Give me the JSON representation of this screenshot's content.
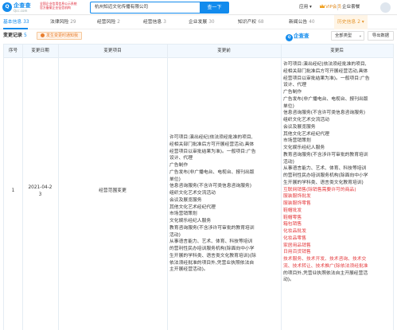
{
  "header": {
    "logo_name": "企查查",
    "logo_domain": "Qcc.com",
    "slogan_lines": [
      "全国企业信用信息公示系统",
      "官方备案企业征信机构"
    ],
    "search_value": "杭州知迈文化传播有限公司",
    "search_button": "查一下",
    "nav_app": "应用",
    "nav_vip": "VIP会员",
    "nav_login": "企业套餐"
  },
  "tabs": [
    {
      "label": "基本信息",
      "count": "33"
    },
    {
      "label": "法律风险",
      "count": "29"
    },
    {
      "label": "经营风险",
      "count": "2"
    },
    {
      "label": "经营信息",
      "count": "3"
    },
    {
      "label": "企业发展",
      "count": "30"
    },
    {
      "label": "知识产权",
      "count": "68"
    },
    {
      "label": "新闻公告",
      "count": "40"
    },
    {
      "label": "历史信息",
      "count": "2"
    }
  ],
  "section": {
    "title": "变更记录",
    "count": "5",
    "warning": "发生变更时通知我",
    "watermark": "企查查",
    "filter_type": "全部类型",
    "export": "导出数据"
  },
  "table": {
    "headers": [
      "序号",
      "变更日期",
      "变更项目",
      "变更前",
      "变更后"
    ],
    "rows": [
      {
        "index": "1",
        "date_lines": [
          "2021-04-2",
          "3"
        ],
        "item": "经营范围变更",
        "before_lines": [
          "许可项目:演出经纪(依法须经批准的项目,",
          "经相关部门批准后方可开展经营活动,具体",
          "经营项目以审批结果为准)。一般项目:广告",
          "设计、代理",
          "广告制作",
          "广告发布(非广播电台、电视台、报刊出版",
          "单位)",
          "信息咨询服务(不含许可类信息咨询服务)",
          "组织文化艺术交流活动",
          "会议及展览服务",
          "其他文化艺术经纪代理",
          "市场营销策划",
          "文化娱乐经纪人服务",
          "教育咨询服务(不含涉许可审批的教育培训",
          "活动)",
          "从事语言能力、艺术、体育、科技等培训",
          "的营利性民办培训服务机构(除面向中小学",
          "生开展的学科类、语言类文化教育培训)(除",
          "依法须经批准的项目外,凭营业执照依法自",
          "主开展经营活动)。"
        ],
        "after_lines": [
          {
            "text": "许可项目:演出经纪(依法须经批准的项目,",
            "hl": false
          },
          {
            "text": "经相关部门批准后方可开展经营活动,具体",
            "hl": false
          },
          {
            "text": "经营项目以审批结果为准)。一般项目:广告",
            "hl": false
          },
          {
            "text": "设计、代理",
            "hl": false
          },
          {
            "text": "广告制作",
            "hl": false
          },
          {
            "text": "广告发布(非广播电台、电视台、报刊出版",
            "hl": false
          },
          {
            "text": "单位)",
            "hl": false
          },
          {
            "text": "信息咨询服务(不含许可类信息咨询服务)",
            "hl": false
          },
          {
            "text": "组织文化艺术交流活动",
            "hl": false
          },
          {
            "text": "会议及展览服务",
            "hl": false
          },
          {
            "text": "其他文化艺术经纪代理",
            "hl": false
          },
          {
            "text": "市场营销策划",
            "hl": false
          },
          {
            "text": "文化娱乐经纪人服务",
            "hl": false
          },
          {
            "text": "教育咨询服务(不含涉许可审批的教育培训",
            "hl": false
          },
          {
            "text": "活动)",
            "hl": false
          },
          {
            "text": "从事语言能力、艺术、体育、科技等培训",
            "hl": false
          },
          {
            "text": "的营利性民办培训服务机构(除面向中小学",
            "hl": false
          },
          {
            "text": "生开展的学科类、语言类文化教育培训)",
            "hl": false
          },
          {
            "text": "互联网销售(除销售需要许可的商品)",
            "hl": true
          },
          {
            "text": "服装服饰批发",
            "hl": true
          },
          {
            "text": "服装服饰零售",
            "hl": true
          },
          {
            "text": "鞋帽批发",
            "hl": true
          },
          {
            "text": "鞋帽零售",
            "hl": true
          },
          {
            "text": "箱包销售",
            "hl": true
          },
          {
            "text": "化妆品批发",
            "hl": true
          },
          {
            "text": "化妆品零售",
            "hl": true
          },
          {
            "text": "家居用品销售",
            "hl": true
          },
          {
            "text": "日用百货销售",
            "hl": true
          },
          {
            "text": "技术服务、技术开发、技术咨询、技术交",
            "hl": true
          },
          {
            "text": "流、技术转让、技术推广(除依法须经批准",
            "hl": true
          },
          {
            "text": "的项目外,凭营业执照依法自主开展经营活",
            "hl": false
          },
          {
            "text": "动)。",
            "hl": false
          }
        ]
      }
    ]
  },
  "colors": {
    "brand": "#128bed",
    "highlight": "#e4393c",
    "history_tab": "#e6962d",
    "table_header_bg": "#f2f8fe"
  }
}
